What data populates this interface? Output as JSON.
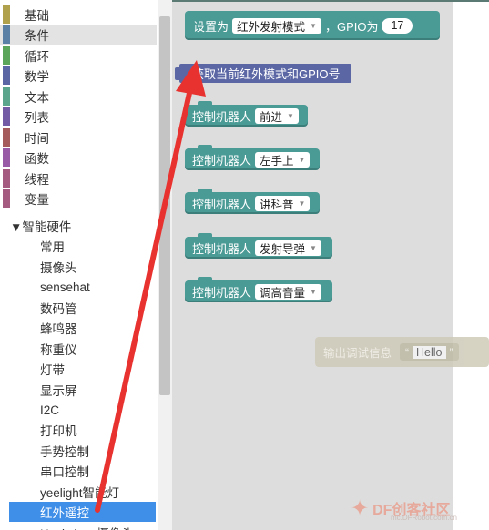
{
  "sidebar": {
    "categories": [
      {
        "label": "基础",
        "color": "#b0a24c"
      },
      {
        "label": "条件",
        "color": "#5b80a5"
      },
      {
        "label": "循环",
        "color": "#5ba55b"
      },
      {
        "label": "数学",
        "color": "#5b67a5"
      },
      {
        "label": "文本",
        "color": "#5ba58c"
      },
      {
        "label": "列表",
        "color": "#745ba5"
      },
      {
        "label": "时间",
        "color": "#a55b5b"
      },
      {
        "label": "函数",
        "color": "#995ba5"
      },
      {
        "label": "线程",
        "color": "#a55b80"
      },
      {
        "label": "变量",
        "color": "#a55b80"
      }
    ],
    "hardware_header": "▼智能硬件",
    "hardware_items": [
      "常用",
      "摄像头",
      "sensehat",
      "数码管",
      "蜂鸣器",
      "称重仪",
      "灯带",
      "显示屏",
      "I2C",
      "打印机",
      "手势控制",
      "串口控制",
      "yeelight智能灯",
      "红外遥控"
    ],
    "active_item": "红外遥控",
    "partial_item": "Huskylens摄像头"
  },
  "blocks": {
    "set_mode": {
      "label_prefix": "设置为",
      "mode": "红外发射模式",
      "label_mid": "，GPIO为",
      "gpio": "17"
    },
    "get_mode": {
      "label": "获取当前红外模式和GPIO号"
    },
    "robot_label": "控制机器人",
    "robot_commands": [
      "前进",
      "左手上",
      "讲科普",
      "发射导弹",
      "调高音量"
    ],
    "ghost": {
      "label": "输出调试信息",
      "open_quote": "“",
      "value": "Hello",
      "close_quote": "”"
    }
  },
  "watermark": {
    "brand": "DF创客社区",
    "site": "mc.DFRobot.com.cn"
  },
  "colors": {
    "block_teal": "#4a9a95",
    "block_purple": "#5b67a5",
    "selected_blue": "#3f8ee8",
    "arrow_red": "#e8322f"
  }
}
